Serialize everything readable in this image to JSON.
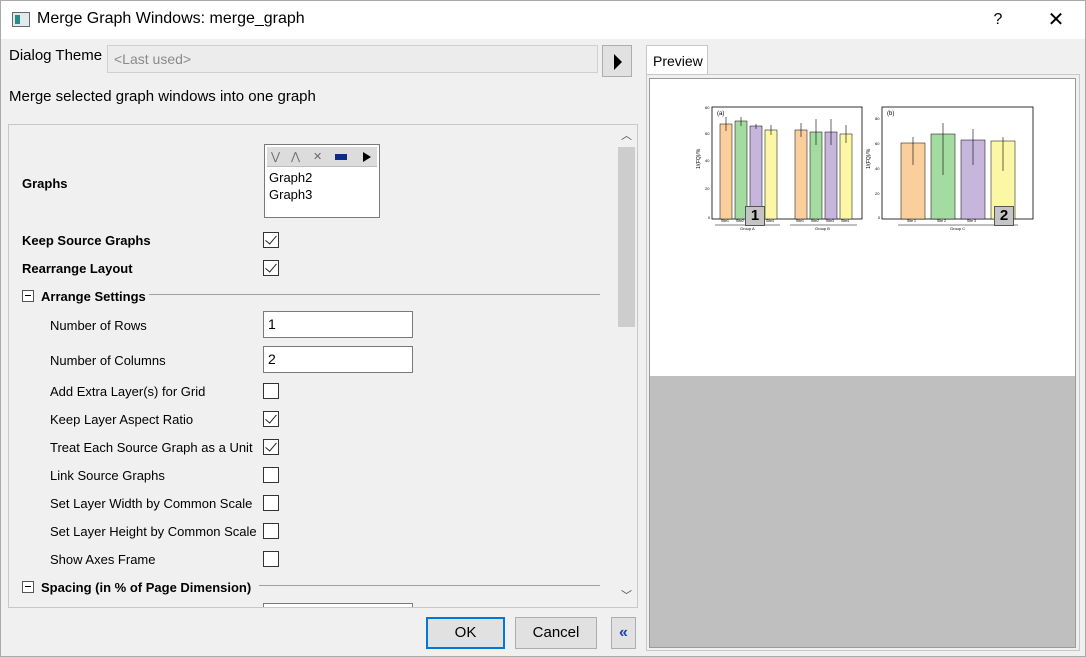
{
  "window": {
    "title": "Merge Graph Windows: merge_graph",
    "help_label": "?",
    "close_label": "✕"
  },
  "theme": {
    "label": "Dialog Theme",
    "value": "<Last used>"
  },
  "description": "Merge selected graph windows into one graph",
  "graphs": {
    "label": "Graphs",
    "items": [
      "Graph2",
      "Graph3"
    ]
  },
  "options": {
    "keep_source_label": "Keep Source Graphs",
    "keep_source_checked": true,
    "rearrange_label": "Rearrange Layout",
    "rearrange_checked": true
  },
  "arrange": {
    "section_label": "Arrange Settings",
    "rows_label": "Number of Rows",
    "rows_value": "1",
    "cols_label": "Number of Columns",
    "cols_value": "2",
    "checks": [
      {
        "label": "Add Extra Layer(s) for Grid",
        "checked": false
      },
      {
        "label": "Keep Layer Aspect Ratio",
        "checked": true
      },
      {
        "label": "Treat Each Source Graph as a Unit",
        "checked": true
      },
      {
        "label": "Link Source Graphs",
        "checked": false
      },
      {
        "label": "Set Layer Width by Common Scale",
        "checked": false
      },
      {
        "label": "Set Layer Height by Common Scale",
        "checked": false
      },
      {
        "label": "Show Axes Frame",
        "checked": false
      }
    ]
  },
  "spacing": {
    "section_label": "Spacing (in % of Page Dimension)"
  },
  "buttons": {
    "ok": "OK",
    "cancel": "Cancel",
    "collapse": "«"
  },
  "preview": {
    "tab_label": "Preview",
    "badge1": "1",
    "badge2": "2",
    "panel_a": {
      "tag": "(a)",
      "ylabel": "1/(FQ)/%",
      "yticks": [
        "60",
        "60",
        "40",
        "40",
        "20",
        "0"
      ],
      "groups": [
        "Group A",
        "Group B"
      ],
      "sites": [
        "Site1",
        "Site2",
        "Site3",
        "Site4"
      ]
    },
    "panel_b": {
      "tag": "(b)",
      "ylabel": "1/(FQ)/%",
      "yticks": [
        "80",
        "60",
        "40",
        "20",
        "0"
      ],
      "groups": [
        "Group C"
      ],
      "sites": [
        "Site 1",
        "Site 2",
        "Site 3"
      ]
    },
    "colors": {
      "orange": "#fbcf9c",
      "green": "#a4dba0",
      "purple": "#c7b6dc",
      "yellow": "#fbf7a4"
    }
  }
}
